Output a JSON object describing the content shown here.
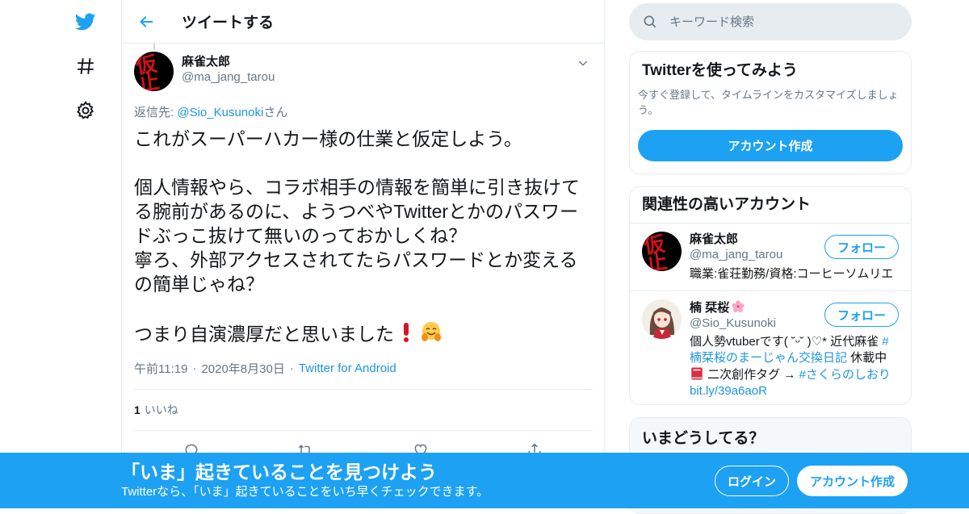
{
  "header": {
    "title": "ツイートする"
  },
  "tweet": {
    "author_name": "麻雀太郎",
    "author_handle": "@ma_jang_tarou",
    "avatar_text": "仮\n止",
    "reply_prefix": "返信先: ",
    "reply_mention": "@Sio_Kusunoki",
    "reply_suffix": "さん",
    "text": "これがスーパーハカー様の仕業と仮定しよう。\n\n個人情報やら、コラボ相手の情報を簡単に引き抜けてる腕前があるのに、ようつべやTwitterとかのパスワードぶっこ抜けて無いのっておかしくね？\n寧ろ、外部アクセスされてたらパスワードとか変えるの簡単じゃね？\n\nつまり自演濃厚だと思いました",
    "emojis": [
      "exclamation-mark",
      "hugging-face"
    ],
    "time": "午前11:19",
    "date": "2020年8月30日",
    "dot": "·",
    "source": "Twitter for Android",
    "likes_count": "1",
    "likes_label": "いいね"
  },
  "search": {
    "placeholder": "キーワード検索"
  },
  "signup_card": {
    "title": "Twitterを使ってみよう",
    "desc": "今すぐ登録して、タイムラインをカスタマイズしましょう。",
    "button": "アカウント作成"
  },
  "related": {
    "title": "関連性の高いアカウント",
    "follow_label": "フォロー",
    "accounts": [
      {
        "name": "麻雀太郎",
        "handle": "@ma_jang_tarou",
        "bio": "職業:雀荘勤務/資格:コーヒーソムリエ"
      },
      {
        "name": "楠 栞桜",
        "name_emoji": "cherry-blossom",
        "handle": "@Sio_Kusunoki",
        "bio_1": "個人勢vtuberです( ˘ᵕ˘ )♡* 近代麻雀 ",
        "bio_link_1": "#楠栞桜のまーじゃん交換日記",
        "bio_2": " 休載中 ",
        "bio_3": " 二次創作タグ → ",
        "bio_link_2": "#さくらのしおり",
        "bio_link_3": "bit.ly/39a6aoR"
      }
    ]
  },
  "now_card": {
    "title": "いまどうしてる？"
  },
  "bottom_bar": {
    "title": "「いま」起きていることを見つけよう",
    "subtitle": "Twitterなら、「いま」起きていることをいち早くチェックできます。",
    "login": "ログイン",
    "signup": "アカウント作成"
  },
  "colors": {
    "accent": "#1da1f2",
    "link": "#1b95e0",
    "muted": "#657786",
    "border": "#e6ecf0"
  }
}
